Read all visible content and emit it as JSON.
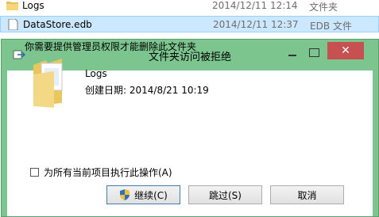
{
  "files": [
    {
      "name": "Logs",
      "date": "2014/12/11 12:14",
      "type": "文件夹",
      "icon": "folder-icon"
    },
    {
      "name": "DataStore.edb",
      "date": "2014/12/11 12:37",
      "type": "EDB 文件",
      "icon": "file-icon"
    }
  ],
  "dialog": {
    "title": "文件夹访问被拒绝",
    "message": "你需要提供管理员权限才能删除此文件夹",
    "item": {
      "name": "Logs",
      "created": "创建日期: 2014/8/21 10:19"
    },
    "checkbox_label": "为所有当前项目执行此操作(A)",
    "buttons": {
      "continue": "继续(C)",
      "skip": "跳过(S)",
      "cancel": "取消"
    },
    "close_glyph": "✕"
  },
  "colors": {
    "titlebar": "#7dc58e",
    "close": "#c75050",
    "selection": "#cce8ff"
  }
}
